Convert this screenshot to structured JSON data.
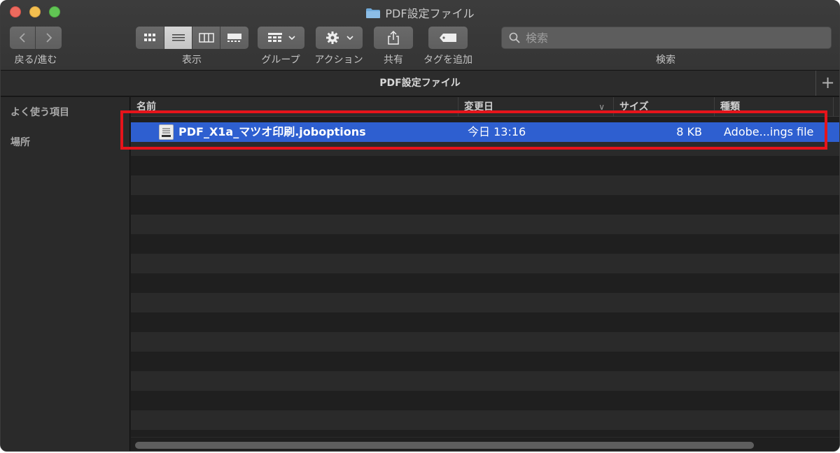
{
  "window": {
    "title": "PDF設定ファイル"
  },
  "toolbar": {
    "nav_label": "戻る/進む",
    "view_label": "表示",
    "group_label": "グループ",
    "action_label": "アクション",
    "share_label": "共有",
    "tag_label": "タグを追加",
    "search_label": "検索",
    "search_placeholder": "検索",
    "active_view": "list"
  },
  "pathbar": {
    "title": "PDF設定ファイル"
  },
  "sidebar": {
    "favorites": "よく使う項目",
    "locations": "場所"
  },
  "columns": {
    "name": "名前",
    "date": "変更日",
    "size": "サイズ",
    "kind": "種類"
  },
  "files": [
    {
      "name": "PDF_X1a_マツオ印刷.joboptions",
      "date": "今日 13:16",
      "size": "8 KB",
      "kind": "Adobe...ings file",
      "selected": true
    }
  ],
  "colors": {
    "selection": "#2e5fd0",
    "highlight_box": "#e6141b",
    "folder": "#6fa9d9"
  },
  "icons": [
    "back-icon",
    "forward-icon",
    "icon-view-icon",
    "list-view-icon",
    "column-view-icon",
    "gallery-view-icon",
    "group-icon",
    "gear-icon",
    "share-icon",
    "tag-icon",
    "search-icon",
    "folder-icon",
    "plus-icon",
    "file-icon"
  ]
}
